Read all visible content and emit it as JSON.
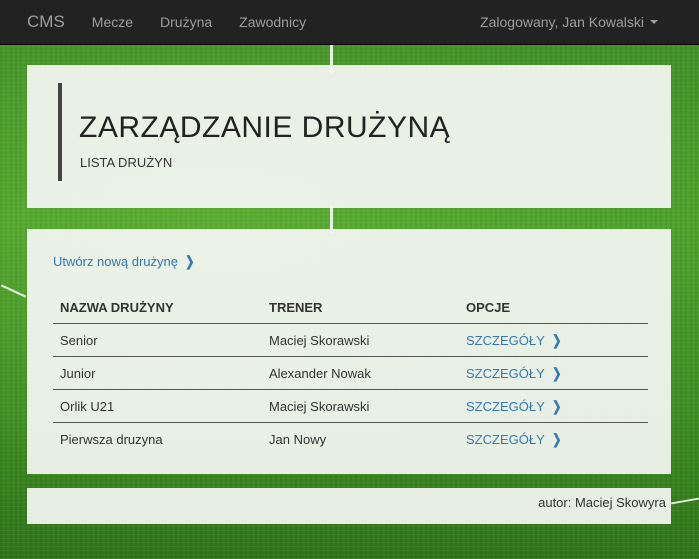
{
  "navbar": {
    "brand": "CMS",
    "links": [
      "Mecze",
      "Drużyna",
      "Zawodnicy"
    ],
    "user": "Zalogowany, Jan Kowalski"
  },
  "header": {
    "title": "ZARZĄDZANIE DRUŻYNĄ",
    "subtitle": "LISTA DRUŻYN"
  },
  "content": {
    "create_link": "Utwórz nową drużynę",
    "columns": [
      "NAZWA DRUŻYNY",
      "TRENER",
      "OPCJE"
    ],
    "rows": [
      {
        "name": "Senior",
        "coach": "Maciej Skorawski",
        "option": "SZCZEGÓŁY"
      },
      {
        "name": "Junior",
        "coach": "Alexander Nowak",
        "option": "SZCZEGÓŁY"
      },
      {
        "name": "Orlik U21",
        "coach": "Maciej Skorawski",
        "option": "SZCZEGÓŁY"
      },
      {
        "name": "Pierwsza druzyna",
        "coach": "Jan Nowy",
        "option": "SZCZEGÓŁY"
      }
    ]
  },
  "footer": {
    "text": "autor: Maciej Skowyra"
  },
  "icons": {
    "chevron": "chevron-right-icon",
    "caret": "caret-down-icon"
  },
  "colors": {
    "navbar": "#222222",
    "link": "#337ab7"
  }
}
